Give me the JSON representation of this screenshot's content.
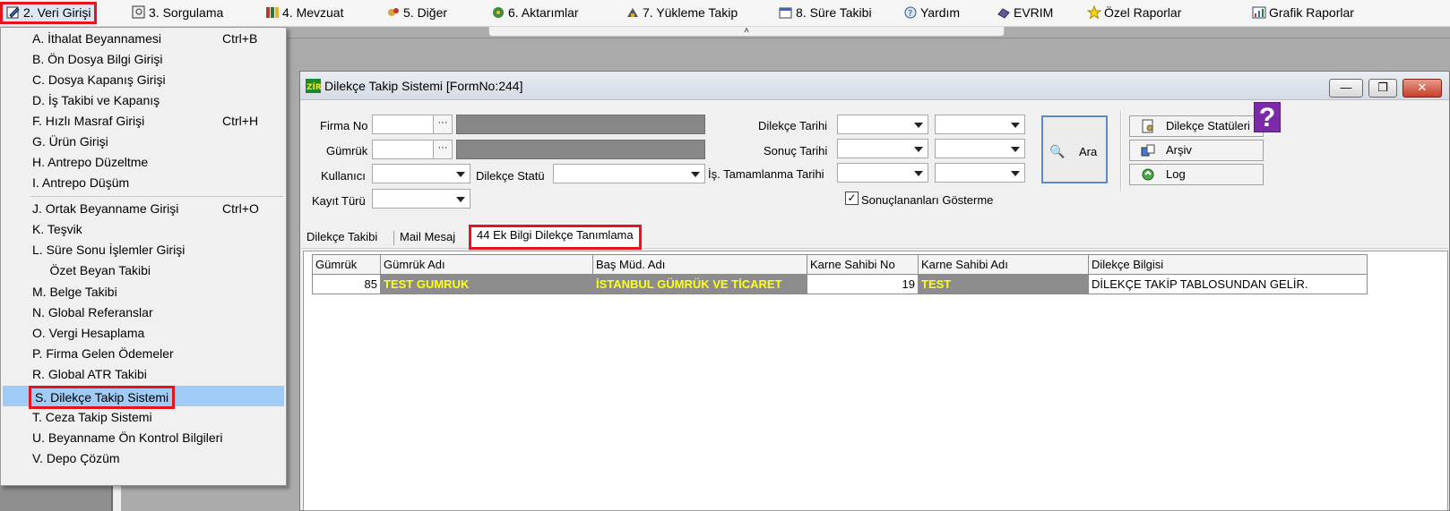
{
  "menubar": {
    "items": [
      {
        "label": "2.  Veri Girişi",
        "icon": "edit-icon"
      },
      {
        "label": "3.   Sorgulama",
        "icon": "query-icon"
      },
      {
        "label": "4.   Mevzuat",
        "icon": "books-icon"
      },
      {
        "label": "5.   Diğer",
        "icon": "tools-icon"
      },
      {
        "label": "6.   Aktarımlar",
        "icon": "transfer-icon"
      },
      {
        "label": "7.   Yükleme Takip",
        "icon": "loading-icon"
      },
      {
        "label": "8. Süre Takibi",
        "icon": "calendar-icon"
      },
      {
        "label": "Yardım",
        "icon": "help-icon"
      },
      {
        "label": "EVRIM",
        "icon": "evrim-icon"
      },
      {
        "label": "Özel Raporlar",
        "icon": "star-icon"
      },
      {
        "label": "Grafik Raporlar",
        "icon": "chart-icon"
      }
    ],
    "collapse_glyph": "˄"
  },
  "dropdown": {
    "items": [
      {
        "label": "A.   İthalat Beyannamesi",
        "shortcut": "Ctrl+B"
      },
      {
        "label": "B.   Ön Dosya Bilgi Girişi",
        "shortcut": ""
      },
      {
        "label": "C.   Dosya Kapanış Girişi",
        "shortcut": ""
      },
      {
        "label": "D.   İş Takibi ve Kapanış",
        "shortcut": ""
      },
      {
        "label": "F.   Hızlı Masraf Girişi",
        "shortcut": "Ctrl+H"
      },
      {
        "label": "G.   Ürün Girişi",
        "shortcut": ""
      },
      {
        "label": "H.   Antrepo Düzeltme",
        "shortcut": ""
      },
      {
        "label": "I.    Antrepo Düşüm",
        "shortcut": ""
      },
      {
        "label": "J.   Ortak Beyanname Girişi",
        "shortcut": "Ctrl+O"
      },
      {
        "label": "K.   Teşvik",
        "shortcut": ""
      },
      {
        "label": "L.   Süre Sonu İşlemler Girişi",
        "shortcut": ""
      },
      {
        "label": "     Özet Beyan Takibi",
        "shortcut": ""
      },
      {
        "label": "M.   Belge Takibi",
        "shortcut": ""
      },
      {
        "label": "N.  Global Referanslar",
        "shortcut": ""
      },
      {
        "label": "O. Vergi Hesaplama",
        "shortcut": ""
      },
      {
        "label": "P. Firma Gelen Ödemeler",
        "shortcut": ""
      },
      {
        "label": "R. Global ATR Takibi",
        "shortcut": ""
      },
      {
        "label": "S. Dilekçe Takip Sistemi",
        "shortcut": ""
      },
      {
        "label": "T. Ceza Takip Sistemi",
        "shortcut": ""
      },
      {
        "label": "U. Beyanname Ön Kontrol Bilgileri",
        "shortcut": ""
      },
      {
        "label": "V. Depo Çözüm",
        "shortcut": ""
      }
    ]
  },
  "window": {
    "app_icon_text": "ZİR",
    "title": "Dilekçe Takip Sistemi [FormNo:244]",
    "min_glyph": "—",
    "max_glyph": "❐",
    "close_glyph": "✕"
  },
  "form": {
    "firma_no_label": "Firma No",
    "gumruk_label": "Gümrük",
    "kullanici_label": "Kullanıcı",
    "dilekce_statu_label": "Dilekçe Statü",
    "kayit_turu_label": "Kayıt Türü",
    "dilekce_tarihi_label": "Dilekçe Tarihi",
    "sonuc_tarihi_label": "Sonuç Tarihi",
    "is_tamamlanma_label": "İş. Tamamlanma Tarihi",
    "ellipsis": "···",
    "ara_label": "Ara",
    "ara_icon": "🔍",
    "dilekce_statuleri_label": "Dilekçe Statüleri",
    "arsiv_label": "Arşiv",
    "log_label": "Log",
    "help_glyph": "?",
    "sonuclananlar_label": "Sonuçlananları Gösterme",
    "sonuclananlar_checked": "✓"
  },
  "tabs": [
    {
      "label": "Dilekçe Takibi"
    },
    {
      "label": "Mail Mesaj"
    },
    {
      "label": "44 Ek Bilgi Dilekçe Tanımlama"
    }
  ],
  "grid": {
    "headers": [
      "Gümrük",
      "Gümrük Adı",
      "Baş Müd. Adı",
      "Karne Sahibi No",
      "Karne Sahibi Adı",
      "Dilekçe Bilgisi"
    ],
    "rows": [
      [
        "85",
        "TEST GUMRUK",
        "İSTANBUL GÜMRÜK VE TİCARET",
        "19",
        "TEST",
        "DİLEKÇE TAKİP TABLOSUNDAN GELİR."
      ]
    ]
  },
  "colors": {
    "highlight_border": "#e8121c",
    "selected_menu_bg": "#9fcbf6",
    "yellow_text": "#ffff16"
  }
}
